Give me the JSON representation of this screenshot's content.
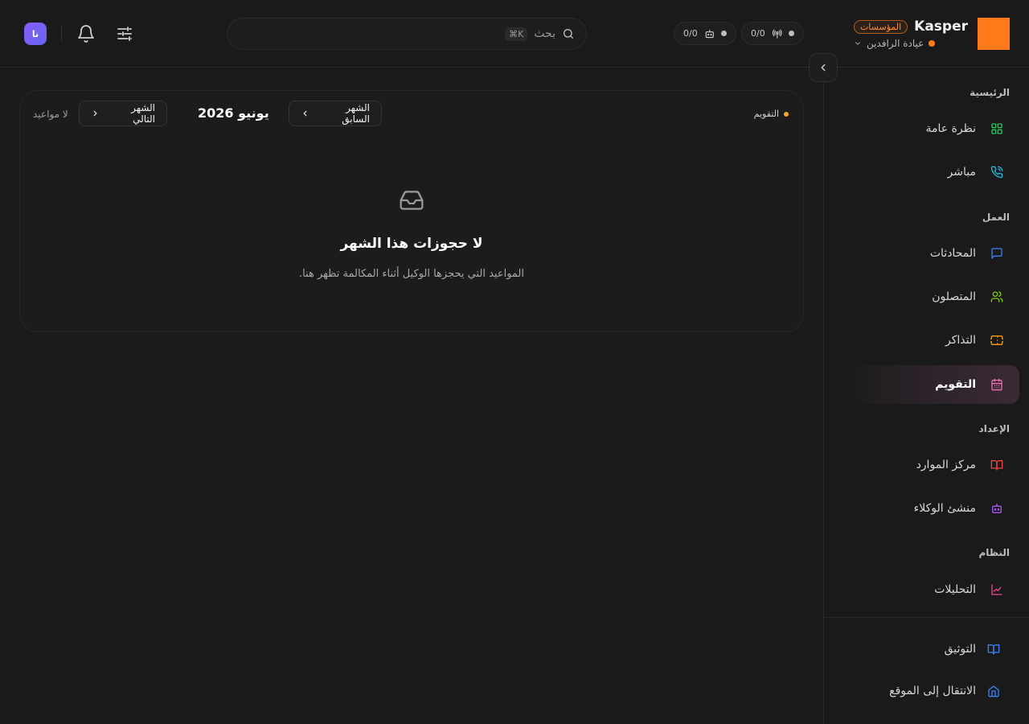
{
  "header": {
    "brand": {
      "name": "Kasper",
      "badge": "المؤسسات",
      "org_name": "عيادة الرافدين",
      "logo_color": "#ff7a1a"
    },
    "counters": [
      {
        "value": "0/0",
        "icon": "antenna-icon"
      },
      {
        "value": "0/0",
        "icon": "bot-icon"
      }
    ],
    "search": {
      "placeholder": "بحث",
      "shortcut": "⌘K"
    },
    "user": {
      "initials": "نا"
    }
  },
  "sidebar": {
    "sections": [
      {
        "label": "الرئيسية"
      },
      {
        "label": "العمل"
      },
      {
        "label": "الإعداد"
      },
      {
        "label": "النظام"
      }
    ],
    "items": [
      {
        "label": "نظرة عامة",
        "icon": "grid-icon",
        "color": "#22c55e"
      },
      {
        "label": "مباشر",
        "icon": "phone-call-icon",
        "color": "#22b8e0"
      },
      {
        "label": "المحادثات",
        "icon": "chat-icon",
        "color": "#3b82f6"
      },
      {
        "label": "المتصلون",
        "icon": "users-icon",
        "color": "#84cc16"
      },
      {
        "label": "التذاكر",
        "icon": "ticket-icon",
        "color": "#f59e0b"
      },
      {
        "label": "التقويم",
        "icon": "calendar-icon",
        "color": "#ec6fb0",
        "active": true
      },
      {
        "label": "مركز الموارد",
        "icon": "book-icon",
        "color": "#ef4444"
      },
      {
        "label": "منشئ الوكلاء",
        "icon": "bot-icon",
        "color": "#a855f7"
      },
      {
        "label": "التحليلات",
        "icon": "line-chart-icon",
        "color": "#ec4899"
      }
    ],
    "footer": [
      {
        "label": "التوثيق",
        "icon": "book-open-icon",
        "color": "#3b82f6"
      },
      {
        "label": "الانتقال إلى الموقع",
        "icon": "home-icon",
        "color": "#3b82f6"
      }
    ]
  },
  "calendar": {
    "section_label": "التقويم",
    "prev_label": "الشهر السابق",
    "next_label": "الشهر التالي",
    "month_title": "يونيو 2026",
    "status": "لا مواعيد",
    "empty_title": "لا حجوزات هذا الشهر",
    "empty_subtitle": "المواعيد التي يحجزها الوكيل أثناء المكالمة تظهر هنا."
  }
}
